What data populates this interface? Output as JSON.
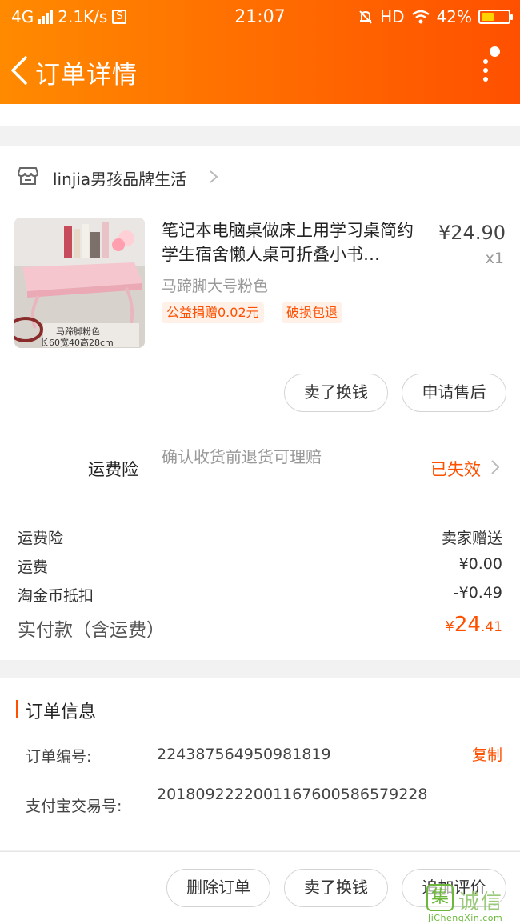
{
  "status_bar": {
    "network": "4G",
    "speed": "2.1K/s",
    "s_icon": "S",
    "time": "21:07",
    "hd": "HD",
    "battery": "42%",
    "battery_level": 0.42
  },
  "header": {
    "title": "订单详情"
  },
  "shop": {
    "name": "linjia男孩品牌生活"
  },
  "product": {
    "title": "笔记本电脑桌做床上用学习桌简约学生宿舍懒人桌可折叠小书…",
    "price": "¥24.90",
    "quantity": "x1",
    "sku": "马蹄脚大号粉色",
    "tags": [
      "公益捐赠0.02元",
      "破损包退"
    ],
    "image_caption_1": "马蹄脚粉色",
    "image_caption_2": "长60宽40高28cm"
  },
  "item_actions": {
    "sell": "卖了换钱",
    "after_sale": "申请售后"
  },
  "insurance": {
    "label": "运费险",
    "desc": "确认收货前退货可理赔",
    "status": "已失效"
  },
  "fees": [
    {
      "label": "运费险",
      "value": "卖家赠送"
    },
    {
      "label": "运费",
      "value": "¥0.00"
    },
    {
      "label": "淘金币抵扣",
      "value": "-¥0.49"
    }
  ],
  "payment": {
    "label": "实付款（含运费）",
    "currency": "¥",
    "integer": "24",
    "decimal": ".41"
  },
  "order_info": {
    "title": "订单信息",
    "order_no_label": "订单编号:",
    "order_no": "224387564950981819",
    "copy": "复制",
    "alipay_label": "支付宝交易号:",
    "alipay_no": "2018092222001167600586579228"
  },
  "bottom_actions": {
    "delete": "删除订单",
    "sell": "卖了换钱",
    "review": "追加评价"
  },
  "watermark": {
    "logo": "集",
    "text": "诚信",
    "url": "JiChengXin.com"
  },
  "colors": {
    "accent": "#ff5000",
    "header_start": "#ff8a00",
    "header_end": "#ff5000"
  }
}
